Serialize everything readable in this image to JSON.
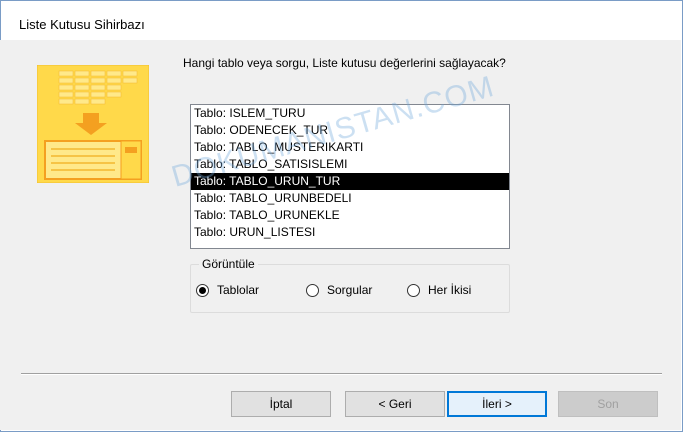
{
  "window": {
    "title": "Liste Kutusu Sihirbazı"
  },
  "wizard": {
    "question": "Hangi tablo veya sorgu, Liste kutusu değerlerini sağlayacak?",
    "list_items": [
      {
        "label": "Tablo: ISLEM_TURU",
        "selected": false
      },
      {
        "label": "Tablo: ODENECEK_TUR",
        "selected": false
      },
      {
        "label": "Tablo: TABLO_MUSTERIKARTI",
        "selected": false
      },
      {
        "label": "Tablo: TABLO_SATISISLEMI",
        "selected": false
      },
      {
        "label": "Tablo: TABLO_URUN_TUR",
        "selected": true
      },
      {
        "label": "Tablo: TABLO_URUNBEDELI",
        "selected": false
      },
      {
        "label": "Tablo: TABLO_URUNEKLE",
        "selected": false
      },
      {
        "label": "Tablo: URUN_LISTESI",
        "selected": false
      }
    ],
    "view": {
      "label": "Görüntüle",
      "options": [
        {
          "label": "Tablolar",
          "checked": true
        },
        {
          "label": "Sorgular",
          "checked": false
        },
        {
          "label": "Her İkisi",
          "checked": false
        }
      ]
    }
  },
  "buttons": {
    "cancel": "İptal",
    "back": "< Geri",
    "next": "İleri >",
    "finish": "Son"
  },
  "watermark": "DOKUMANISTAN.COM",
  "colors": {
    "selection": "#000000",
    "default_button_border": "#0078d7",
    "art_yellow": "#ffd94a",
    "art_orange": "#f4a020"
  }
}
